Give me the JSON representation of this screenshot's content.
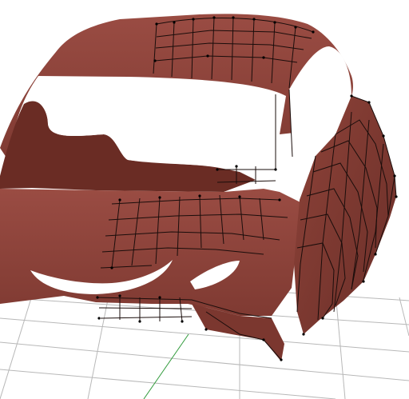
{
  "viewport": {
    "background": "#ffffff",
    "grid_color": "#b8b8b8",
    "axis_x_color": "#c14040",
    "axis_z_color": "#2f9a3a"
  },
  "model": {
    "fill": "#8a4138",
    "fill_dark": "#6e302a",
    "fill_light": "#a65a50",
    "wire_color": "#1a0d0b",
    "vertex_color": "#000000"
  }
}
